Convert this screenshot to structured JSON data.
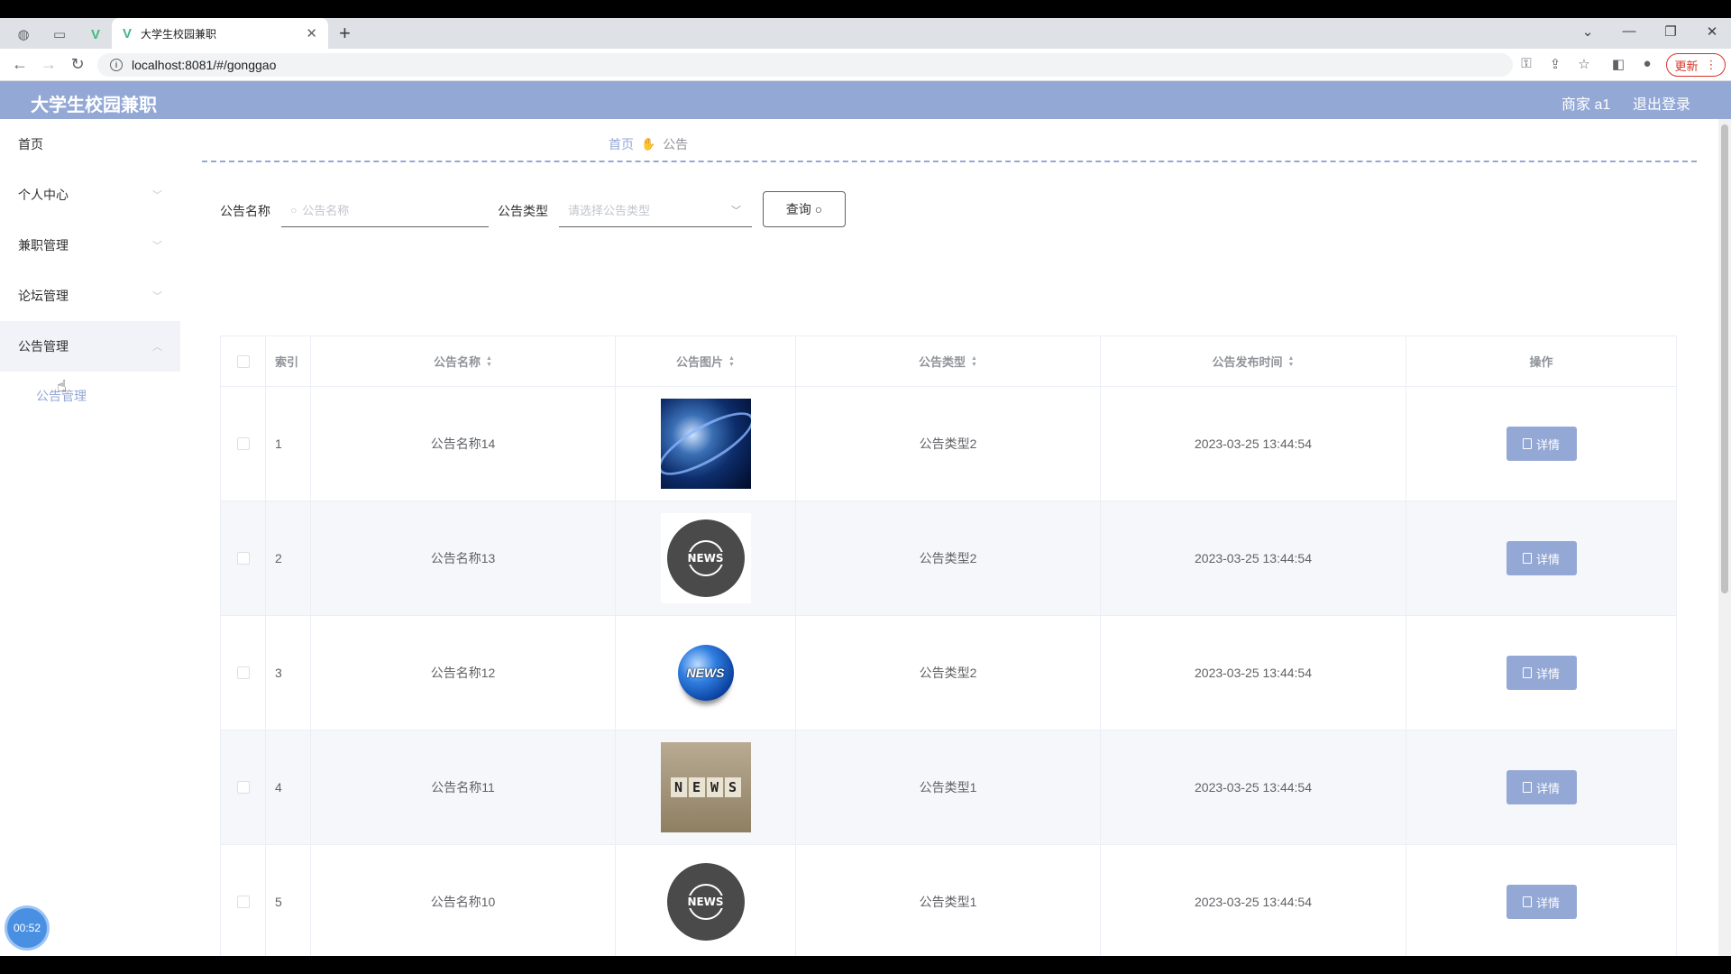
{
  "browser": {
    "tab_title": "大学生校园兼职",
    "url": "localhost:8081/#/gonggao",
    "update_label": "更新"
  },
  "header": {
    "title": "大学生校园兼职",
    "user": "商家 a1",
    "logout": "退出登录"
  },
  "sidebar": {
    "items": [
      {
        "label": "首页"
      },
      {
        "label": "个人中心"
      },
      {
        "label": "兼职管理"
      },
      {
        "label": "论坛管理"
      },
      {
        "label": "公告管理"
      }
    ],
    "sub_item": "公告管理"
  },
  "breadcrumb": {
    "home": "首页",
    "current": "公告"
  },
  "search": {
    "name_label": "公告名称",
    "name_placeholder": "公告名称",
    "type_label": "公告类型",
    "type_placeholder": "请选择公告类型",
    "query_label": "查询"
  },
  "table": {
    "headers": {
      "index": "索引",
      "name": "公告名称",
      "image": "公告图片",
      "type": "公告类型",
      "time": "公告发布时间",
      "op": "操作"
    },
    "detail_label": "详情",
    "rows": [
      {
        "index": "1",
        "name": "公告名称14",
        "image": "globe-news-image",
        "type": "公告类型2",
        "time": "2023-03-25 13:44:54"
      },
      {
        "index": "2",
        "name": "公告名称13",
        "image": "news-circle-image",
        "type": "公告类型2",
        "time": "2023-03-25 13:44:54"
      },
      {
        "index": "3",
        "name": "公告名称12",
        "image": "news-globe-image",
        "type": "公告类型2",
        "time": "2023-03-25 13:44:54"
      },
      {
        "index": "4",
        "name": "公告名称11",
        "image": "news-cubes-image",
        "type": "公告类型1",
        "time": "2023-03-25 13:44:54"
      },
      {
        "index": "5",
        "name": "公告名称10",
        "image": "news-circle-image",
        "type": "公告类型1",
        "time": "2023-03-25 13:44:54"
      }
    ]
  },
  "timer": "00:52",
  "colors": {
    "accent": "#94a8d6"
  }
}
